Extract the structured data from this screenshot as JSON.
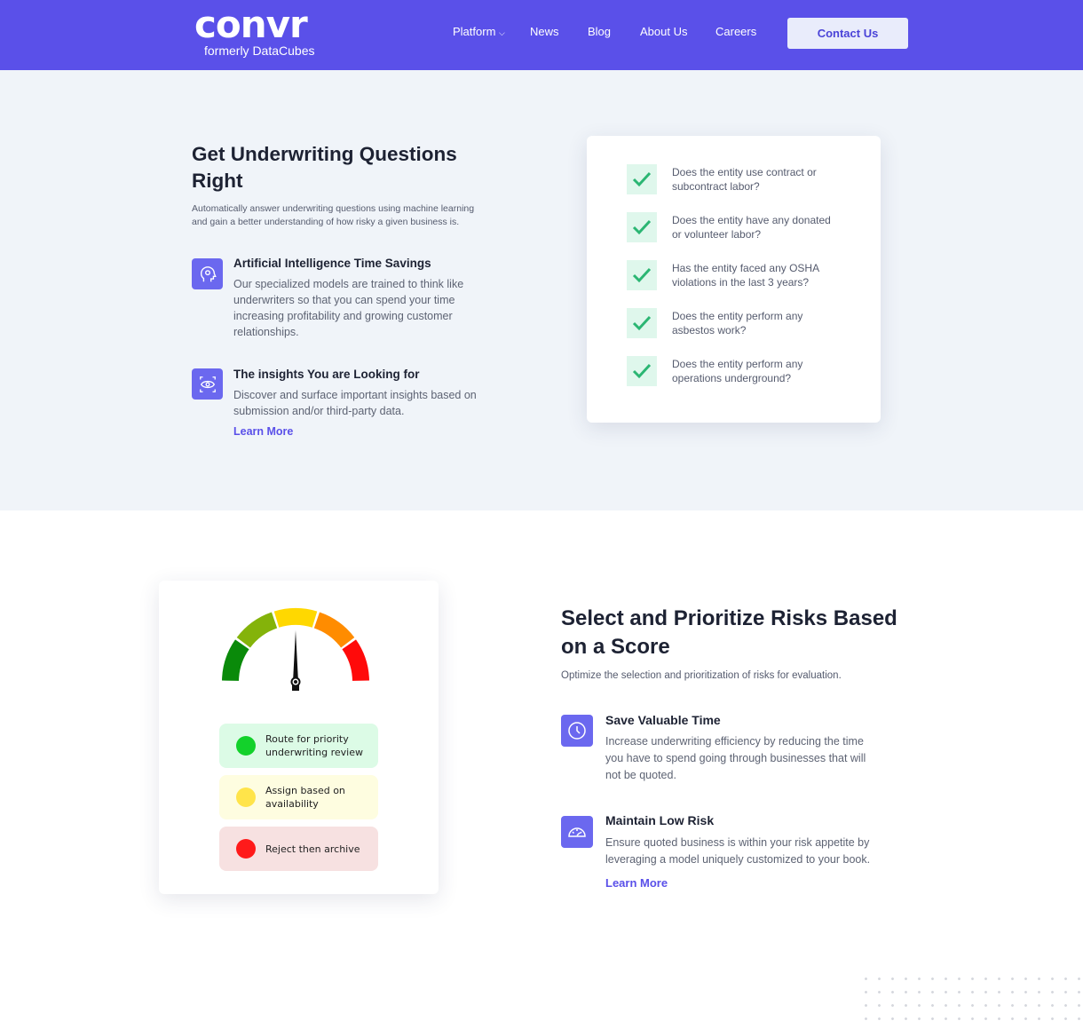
{
  "header": {
    "logo": "convr",
    "logo_sub": "formerly DataCubes",
    "nav": [
      {
        "label": "Platform"
      },
      {
        "label": "News"
      },
      {
        "label": "Blog"
      },
      {
        "label": "About Us"
      },
      {
        "label": "Careers"
      }
    ],
    "contact": "Contact Us",
    "bg": "#5a50e9"
  },
  "section1": {
    "title_line1": "Get Underwriting Questions",
    "title_line2": "Right",
    "desc_line1": "Automatically answer underwriting questions using machine learning",
    "desc_line2": "and gain a better understanding of how risky a given business is.",
    "features": [
      {
        "icon": "head-gear-icon",
        "title": "Artificial Intelligence Time Savings",
        "lines": [
          "Our specialized models are trained to think like",
          "underwriters so that you can spend your time",
          "increasing profitability and growing customer",
          "relationships."
        ]
      },
      {
        "icon": "eye-scan-icon",
        "title": "The insights You are Looking for",
        "lines": [
          "Discover and surface important insights based on",
          "submission and/or third-party data."
        ]
      }
    ],
    "learn_more": "Learn More",
    "questions": [
      [
        "Does the entity use contract or",
        "subcontract labor?"
      ],
      [
        "Does the entity have any donated",
        "or volunteer labor?"
      ],
      [
        "Has the entity faced any OSHA",
        "violations in the last 3 years?"
      ],
      [
        "Does the entity perform any",
        "asbestos work?"
      ],
      [
        "Does the entity perform any",
        "operations underground?"
      ]
    ]
  },
  "section2": {
    "title_line1": "Select and Prioritize Risks Based",
    "title_line2": "on a Score",
    "desc": "Optimize the selection and prioritization of risks for evaluation.",
    "gauge_colors": [
      "#0a8a0a",
      "#84b30a",
      "#ffd800",
      "#ff8c00",
      "#ff0a0a"
    ],
    "options": [
      {
        "lines": [
          "Route for priority",
          "underwriting review"
        ],
        "bg": "#dcfbe6",
        "dot": "#13d12b"
      },
      {
        "lines": [
          "Assign based on",
          "availability"
        ],
        "bg": "#fefde0",
        "dot": "#ffe44a"
      },
      {
        "lines": [
          "Reject then archive"
        ],
        "bg": "#f7e1e1",
        "dot": "#ff1a1a"
      }
    ],
    "features": [
      {
        "icon": "clock-icon",
        "title": "Save Valuable Time",
        "lines": [
          "Increase underwriting efficiency by reducing the time",
          "you have to spend going through businesses that will",
          "not be quoted."
        ]
      },
      {
        "icon": "speedometer-icon",
        "title": "Maintain Low Risk",
        "lines": [
          "Ensure quoted business is within your risk appetite by",
          "leveraging a model uniquely customized to your book."
        ]
      }
    ],
    "learn_more": "Learn More"
  }
}
